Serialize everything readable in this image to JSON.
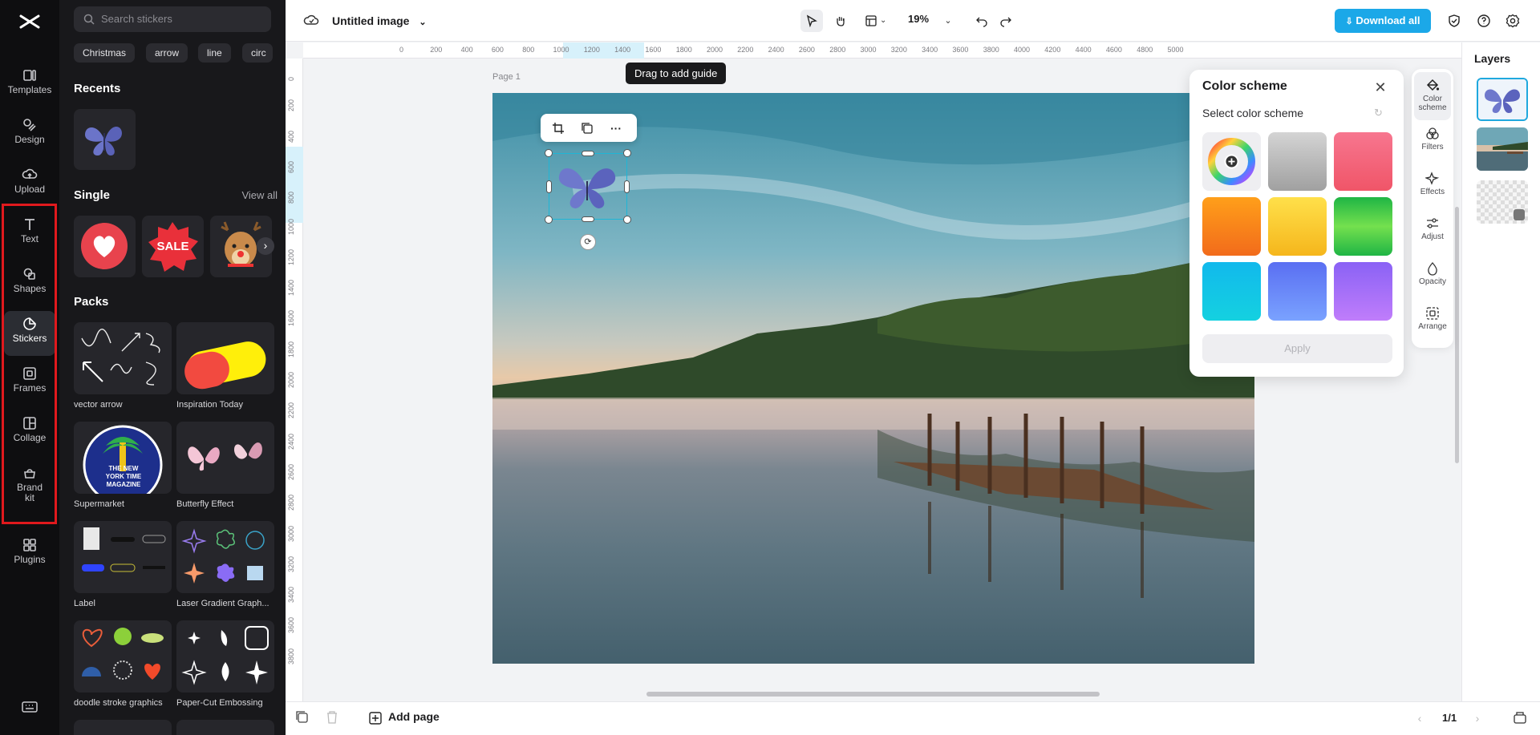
{
  "rail": {
    "logo": "CapCut",
    "items": [
      {
        "label": "Templates",
        "icon": "templates-icon"
      },
      {
        "label": "Design",
        "icon": "design-icon"
      },
      {
        "label": "Upload",
        "icon": "upload-icon"
      },
      {
        "label": "Text",
        "icon": "text-icon"
      },
      {
        "label": "Shapes",
        "icon": "shapes-icon"
      },
      {
        "label": "Stickers",
        "icon": "stickers-icon",
        "active": true
      },
      {
        "label": "Frames",
        "icon": "frames-icon"
      },
      {
        "label": "Collage",
        "icon": "collage-icon"
      },
      {
        "label": "Brand kit",
        "icon": "brand-kit-icon"
      },
      {
        "label": "Plugins",
        "icon": "plugins-icon"
      }
    ],
    "highlight_color": "#e0191d"
  },
  "panel": {
    "search_placeholder": "Search stickers",
    "chips": [
      "Christmas",
      "arrow",
      "line",
      "circ"
    ],
    "recents_title": "Recents",
    "single_title": "Single",
    "view_all": "View all",
    "single_items": [
      "heart",
      "SALE",
      "reindeer"
    ],
    "packs_title": "Packs",
    "packs": [
      {
        "caption": "vector arrow"
      },
      {
        "caption": "Inspiration Today"
      },
      {
        "caption": "Supermarket"
      },
      {
        "caption": "Butterfly Effect"
      },
      {
        "caption": "Label"
      },
      {
        "caption": "Laser Gradient Graph..."
      },
      {
        "caption": "doodle stroke graphics"
      },
      {
        "caption": "Paper-Cut Embossing"
      }
    ],
    "badge_text": [
      "THE",
      "NEW",
      "YORK",
      "TIME",
      "MAGAZINE"
    ],
    "sale_text": "SALE"
  },
  "topbar": {
    "title": "Untitled image",
    "zoom": "19%",
    "download_label": "Download all",
    "accent": "#1ba8e8"
  },
  "canvas": {
    "page_label": "Page 1",
    "guide_tooltip": "Drag to add guide",
    "ruler_h": [
      "0",
      "200",
      "400",
      "600",
      "800",
      "1000",
      "1200",
      "1400",
      "1600",
      "1800",
      "2000",
      "2200",
      "2400",
      "2600",
      "2800",
      "3000",
      "3200",
      "3400",
      "3600",
      "3800",
      "4000",
      "4200",
      "4400",
      "4600",
      "4800",
      "5000"
    ],
    "ruler_v": [
      "0",
      "200",
      "400",
      "600",
      "800",
      "1000",
      "1200",
      "1400",
      "1600",
      "1800",
      "2000",
      "2200",
      "2400",
      "2600",
      "2800",
      "3000",
      "3200",
      "3400",
      "3600",
      "3800"
    ]
  },
  "color_scheme": {
    "title": "Color scheme",
    "subtitle": "Select color scheme",
    "apply_label": "Apply",
    "swatches": [
      {
        "name": "custom",
        "colors": [
          "#f0f0f2"
        ]
      },
      {
        "name": "gray",
        "colors": [
          "#d0d0d0",
          "#9c9c9c"
        ]
      },
      {
        "name": "pink",
        "colors": [
          "#f77090",
          "#f0566b"
        ]
      },
      {
        "name": "orange",
        "colors": [
          "#ff9f1a",
          "#f26b1b"
        ]
      },
      {
        "name": "yellow",
        "colors": [
          "#ffd93b",
          "#f5b61c"
        ]
      },
      {
        "name": "green",
        "colors": [
          "#64e052",
          "#19b545"
        ]
      },
      {
        "name": "cyan",
        "colors": [
          "#1fc9ea",
          "#0aa3e6"
        ]
      },
      {
        "name": "blue",
        "colors": [
          "#6b8cff",
          "#4e6df0"
        ]
      },
      {
        "name": "purple",
        "colors": [
          "#b17cfb",
          "#8b5df5"
        ]
      }
    ]
  },
  "tools": [
    {
      "label": "Color scheme",
      "icon": "paint-bucket-icon",
      "active": true
    },
    {
      "label": "Filters",
      "icon": "filters-icon"
    },
    {
      "label": "Effects",
      "icon": "effects-icon"
    },
    {
      "label": "Adjust",
      "icon": "adjust-icon"
    },
    {
      "label": "Opacity",
      "icon": "opacity-icon"
    },
    {
      "label": "Arrange",
      "icon": "arrange-icon"
    }
  ],
  "layers": {
    "title": "Layers",
    "items": [
      "butterfly sticker",
      "lake photo",
      "transparent background"
    ]
  },
  "bottombar": {
    "add_page": "Add page",
    "page_count": "1/1"
  }
}
